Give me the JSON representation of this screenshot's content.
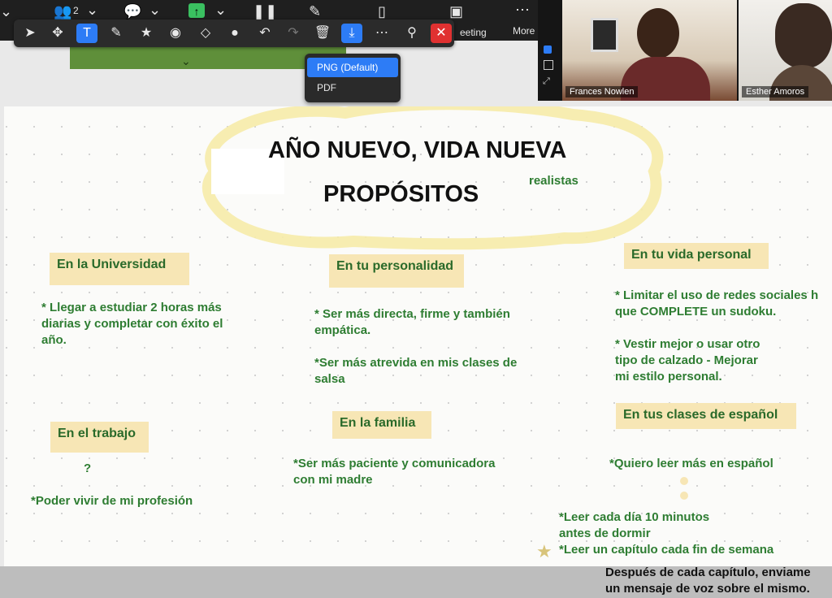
{
  "topbar": {
    "participants_count": "2",
    "meeting_label": "eeting",
    "more_label": "More"
  },
  "dropdown": {
    "options": [
      "PNG (Default)",
      "PDF"
    ]
  },
  "videos": [
    {
      "name": "Frances Nowlen"
    },
    {
      "name": "Esther Amoros"
    }
  ],
  "board": {
    "title1": "AÑO NUEVO, VIDA NUEVA",
    "title2": "PROPÓSITOS",
    "realistas": "realistas",
    "university": {
      "label": "En la Universidad",
      "items": [
        "* Llegar a estudiar 2 horas más",
        "diarias y completar con éxito el",
        "año."
      ]
    },
    "personality": {
      "label": "En tu personalidad",
      "items": [
        "* Ser más directa, firme y también",
        "empática.",
        "*Ser más atrevida en mis clases de",
        "salsa"
      ]
    },
    "personal": {
      "label": "En tu vida personal",
      "items": [
        "* Limitar el uso de redes sociales h",
        "que COMPLETE un sudoku.",
        "* Vestir mejor o usar otro",
        "tipo de calzado - Mejorar",
        "mi estilo personal."
      ]
    },
    "work": {
      "label": "En el trabajo",
      "question": "?",
      "item": "*Poder vivir de mi profesión"
    },
    "family": {
      "label": "En la familia",
      "items": [
        "*Ser más paciente y comunicadora",
        "con mi madre"
      ]
    },
    "spanish": {
      "label": "En tus clases de español",
      "items": [
        "*Quiero leer más en español",
        "*Leer cada día 10 minutos",
        "antes de dormir",
        "*Leer un capítulo cada fin de semana"
      ]
    },
    "note": [
      "Después de cada capítulo, enviame",
      "un mensaje de voz sobre el mismo."
    ]
  }
}
